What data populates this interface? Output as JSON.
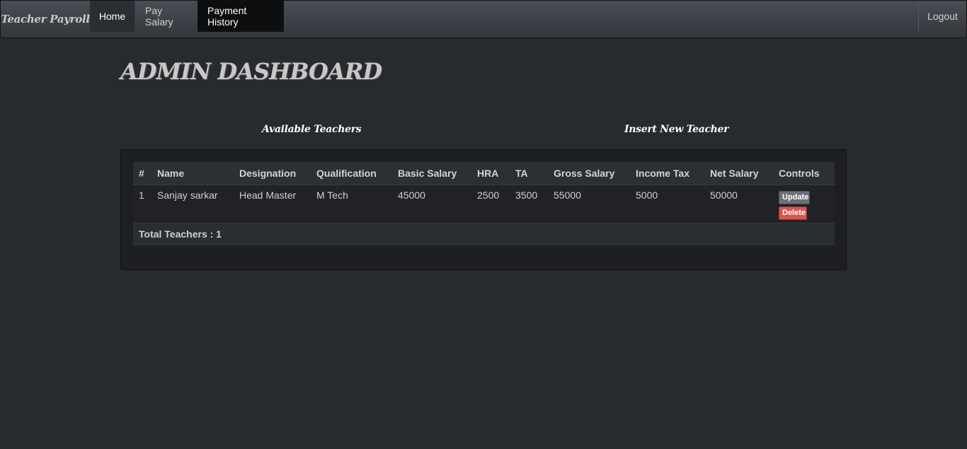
{
  "navbar": {
    "brand": "Teacher Payroll",
    "items": [
      {
        "label": "Home"
      },
      {
        "label": "Pay Salary"
      },
      {
        "label": "Payment History"
      }
    ],
    "logout": "Logout"
  },
  "page_title": "ADMIN DASHBOARD",
  "sections": {
    "available": "Available Teachers",
    "insert": "Insert New Teacher"
  },
  "table": {
    "headers": [
      "#",
      "Name",
      "Designation",
      "Qualification",
      "Basic Salary",
      "HRA",
      "TA",
      "Gross Salary",
      "Income Tax",
      "Net Salary",
      "Controls"
    ],
    "rows": [
      [
        "1",
        "Sanjay sarkar",
        "Head Master",
        "M Tech",
        "45000",
        "2500",
        "3500",
        "55000",
        "5000",
        "50000"
      ]
    ],
    "controls": {
      "update": "Update",
      "delete": "Delete"
    },
    "total": "Total Teachers : 1"
  }
}
